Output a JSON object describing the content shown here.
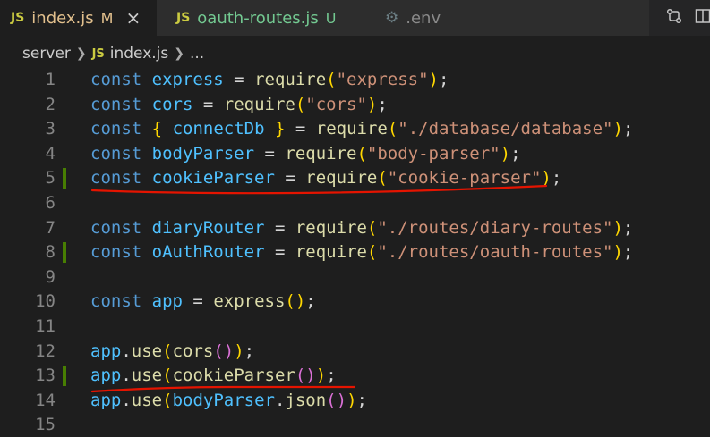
{
  "tabs": [
    {
      "icon": "JS",
      "name": "index.js",
      "state": "M"
    },
    {
      "icon": "JS",
      "name": "oauth-routes.js",
      "state": "U"
    },
    {
      "name": ".env"
    }
  ],
  "tab_close": "×",
  "breadcrumb": {
    "folder": "server",
    "file_icon": "JS",
    "file": "index.js",
    "ellipsis": "..."
  },
  "lines": [
    {
      "n": "1",
      "modified": false,
      "tokens": [
        {
          "c": "kw",
          "t": "const"
        },
        {
          "c": "plain",
          "t": " "
        },
        {
          "c": "var",
          "t": "express"
        },
        {
          "c": "plain",
          "t": " = "
        },
        {
          "c": "fn",
          "t": "require"
        },
        {
          "c": "p1",
          "t": "("
        },
        {
          "c": "str",
          "t": "\"express\""
        },
        {
          "c": "p1",
          "t": ")"
        },
        {
          "c": "plain",
          "t": ";"
        }
      ]
    },
    {
      "n": "2",
      "modified": false,
      "tokens": [
        {
          "c": "kw",
          "t": "const"
        },
        {
          "c": "plain",
          "t": " "
        },
        {
          "c": "var",
          "t": "cors"
        },
        {
          "c": "plain",
          "t": " = "
        },
        {
          "c": "fn",
          "t": "require"
        },
        {
          "c": "p1",
          "t": "("
        },
        {
          "c": "str",
          "t": "\"cors\""
        },
        {
          "c": "p1",
          "t": ")"
        },
        {
          "c": "plain",
          "t": ";"
        }
      ]
    },
    {
      "n": "3",
      "modified": false,
      "tokens": [
        {
          "c": "kw",
          "t": "const"
        },
        {
          "c": "plain",
          "t": " "
        },
        {
          "c": "p1",
          "t": "{"
        },
        {
          "c": "plain",
          "t": " "
        },
        {
          "c": "var",
          "t": "connectDb"
        },
        {
          "c": "plain",
          "t": " "
        },
        {
          "c": "p1",
          "t": "}"
        },
        {
          "c": "plain",
          "t": " = "
        },
        {
          "c": "fn",
          "t": "require"
        },
        {
          "c": "p1",
          "t": "("
        },
        {
          "c": "str",
          "t": "\"./database/database\""
        },
        {
          "c": "p1",
          "t": ")"
        },
        {
          "c": "plain",
          "t": ";"
        }
      ]
    },
    {
      "n": "4",
      "modified": false,
      "tokens": [
        {
          "c": "kw",
          "t": "const"
        },
        {
          "c": "plain",
          "t": " "
        },
        {
          "c": "var",
          "t": "bodyParser"
        },
        {
          "c": "plain",
          "t": " = "
        },
        {
          "c": "fn",
          "t": "require"
        },
        {
          "c": "p1",
          "t": "("
        },
        {
          "c": "str",
          "t": "\"body-parser\""
        },
        {
          "c": "p1",
          "t": ")"
        },
        {
          "c": "plain",
          "t": ";"
        }
      ]
    },
    {
      "n": "5",
      "modified": true,
      "tokens": [
        {
          "c": "kw",
          "t": "const"
        },
        {
          "c": "plain",
          "t": " "
        },
        {
          "c": "var",
          "t": "cookieParser"
        },
        {
          "c": "plain",
          "t": " = "
        },
        {
          "c": "fn",
          "t": "require"
        },
        {
          "c": "p1",
          "t": "("
        },
        {
          "c": "str",
          "t": "\"cookie-parser\""
        },
        {
          "c": "p1",
          "t": ")"
        },
        {
          "c": "plain",
          "t": ";"
        }
      ]
    },
    {
      "n": "6",
      "modified": false,
      "tokens": []
    },
    {
      "n": "7",
      "modified": false,
      "tokens": [
        {
          "c": "kw",
          "t": "const"
        },
        {
          "c": "plain",
          "t": " "
        },
        {
          "c": "var",
          "t": "diaryRouter"
        },
        {
          "c": "plain",
          "t": " = "
        },
        {
          "c": "fn",
          "t": "require"
        },
        {
          "c": "p1",
          "t": "("
        },
        {
          "c": "str",
          "t": "\"./routes/diary-routes\""
        },
        {
          "c": "p1",
          "t": ")"
        },
        {
          "c": "plain",
          "t": ";"
        }
      ]
    },
    {
      "n": "8",
      "modified": true,
      "tokens": [
        {
          "c": "kw",
          "t": "const"
        },
        {
          "c": "plain",
          "t": " "
        },
        {
          "c": "var",
          "t": "oAuthRouter"
        },
        {
          "c": "plain",
          "t": " = "
        },
        {
          "c": "fn",
          "t": "require"
        },
        {
          "c": "p1",
          "t": "("
        },
        {
          "c": "str",
          "t": "\"./routes/oauth-routes\""
        },
        {
          "c": "p1",
          "t": ")"
        },
        {
          "c": "plain",
          "t": ";"
        }
      ]
    },
    {
      "n": "9",
      "modified": false,
      "tokens": []
    },
    {
      "n": "10",
      "modified": false,
      "tokens": [
        {
          "c": "kw",
          "t": "const"
        },
        {
          "c": "plain",
          "t": " "
        },
        {
          "c": "var",
          "t": "app"
        },
        {
          "c": "plain",
          "t": " = "
        },
        {
          "c": "fn",
          "t": "express"
        },
        {
          "c": "p1",
          "t": "()"
        },
        {
          "c": "plain",
          "t": ";"
        }
      ]
    },
    {
      "n": "11",
      "modified": false,
      "tokens": []
    },
    {
      "n": "12",
      "modified": false,
      "tokens": [
        {
          "c": "var",
          "t": "app"
        },
        {
          "c": "plain",
          "t": "."
        },
        {
          "c": "fn",
          "t": "use"
        },
        {
          "c": "p1",
          "t": "("
        },
        {
          "c": "fn",
          "t": "cors"
        },
        {
          "c": "p2",
          "t": "()"
        },
        {
          "c": "p1",
          "t": ")"
        },
        {
          "c": "plain",
          "t": ";"
        }
      ]
    },
    {
      "n": "13",
      "modified": true,
      "tokens": [
        {
          "c": "var",
          "t": "app"
        },
        {
          "c": "plain",
          "t": "."
        },
        {
          "c": "fn",
          "t": "use"
        },
        {
          "c": "p1",
          "t": "("
        },
        {
          "c": "fn",
          "t": "cookieParser"
        },
        {
          "c": "p2",
          "t": "()"
        },
        {
          "c": "p1",
          "t": ")"
        },
        {
          "c": "plain",
          "t": ";"
        }
      ]
    },
    {
      "n": "14",
      "modified": false,
      "tokens": [
        {
          "c": "var",
          "t": "app"
        },
        {
          "c": "plain",
          "t": "."
        },
        {
          "c": "fn",
          "t": "use"
        },
        {
          "c": "p1",
          "t": "("
        },
        {
          "c": "var",
          "t": "bodyParser"
        },
        {
          "c": "plain",
          "t": "."
        },
        {
          "c": "fn",
          "t": "json"
        },
        {
          "c": "p2",
          "t": "()"
        },
        {
          "c": "p1",
          "t": ")"
        },
        {
          "c": "plain",
          "t": ";"
        }
      ]
    },
    {
      "n": "15",
      "modified": false,
      "tokens": []
    }
  ],
  "annotation_color": "#e51400"
}
